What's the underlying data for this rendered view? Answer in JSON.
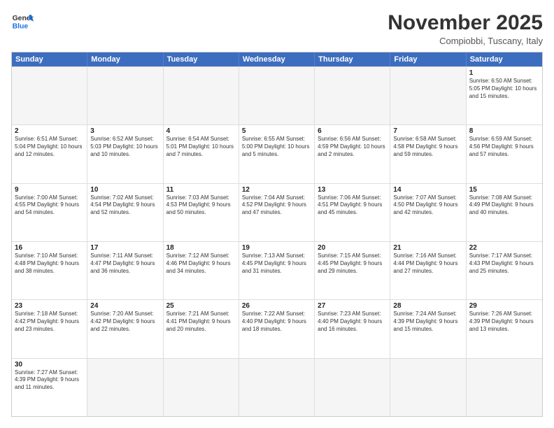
{
  "header": {
    "logo_general": "General",
    "logo_blue": "Blue",
    "month_year": "November 2025",
    "location": "Compiobbi, Tuscany, Italy"
  },
  "days_of_week": [
    "Sunday",
    "Monday",
    "Tuesday",
    "Wednesday",
    "Thursday",
    "Friday",
    "Saturday"
  ],
  "weeks": [
    [
      {
        "day": "",
        "info": ""
      },
      {
        "day": "",
        "info": ""
      },
      {
        "day": "",
        "info": ""
      },
      {
        "day": "",
        "info": ""
      },
      {
        "day": "",
        "info": ""
      },
      {
        "day": "",
        "info": ""
      },
      {
        "day": "1",
        "info": "Sunrise: 6:50 AM\nSunset: 5:05 PM\nDaylight: 10 hours and 15 minutes."
      }
    ],
    [
      {
        "day": "2",
        "info": "Sunrise: 6:51 AM\nSunset: 5:04 PM\nDaylight: 10 hours and 12 minutes."
      },
      {
        "day": "3",
        "info": "Sunrise: 6:52 AM\nSunset: 5:03 PM\nDaylight: 10 hours and 10 minutes."
      },
      {
        "day": "4",
        "info": "Sunrise: 6:54 AM\nSunset: 5:01 PM\nDaylight: 10 hours and 7 minutes."
      },
      {
        "day": "5",
        "info": "Sunrise: 6:55 AM\nSunset: 5:00 PM\nDaylight: 10 hours and 5 minutes."
      },
      {
        "day": "6",
        "info": "Sunrise: 6:56 AM\nSunset: 4:59 PM\nDaylight: 10 hours and 2 minutes."
      },
      {
        "day": "7",
        "info": "Sunrise: 6:58 AM\nSunset: 4:58 PM\nDaylight: 9 hours and 59 minutes."
      },
      {
        "day": "8",
        "info": "Sunrise: 6:59 AM\nSunset: 4:56 PM\nDaylight: 9 hours and 57 minutes."
      }
    ],
    [
      {
        "day": "9",
        "info": "Sunrise: 7:00 AM\nSunset: 4:55 PM\nDaylight: 9 hours and 54 minutes."
      },
      {
        "day": "10",
        "info": "Sunrise: 7:02 AM\nSunset: 4:54 PM\nDaylight: 9 hours and 52 minutes."
      },
      {
        "day": "11",
        "info": "Sunrise: 7:03 AM\nSunset: 4:53 PM\nDaylight: 9 hours and 50 minutes."
      },
      {
        "day": "12",
        "info": "Sunrise: 7:04 AM\nSunset: 4:52 PM\nDaylight: 9 hours and 47 minutes."
      },
      {
        "day": "13",
        "info": "Sunrise: 7:06 AM\nSunset: 4:51 PM\nDaylight: 9 hours and 45 minutes."
      },
      {
        "day": "14",
        "info": "Sunrise: 7:07 AM\nSunset: 4:50 PM\nDaylight: 9 hours and 42 minutes."
      },
      {
        "day": "15",
        "info": "Sunrise: 7:08 AM\nSunset: 4:49 PM\nDaylight: 9 hours and 40 minutes."
      }
    ],
    [
      {
        "day": "16",
        "info": "Sunrise: 7:10 AM\nSunset: 4:48 PM\nDaylight: 9 hours and 38 minutes."
      },
      {
        "day": "17",
        "info": "Sunrise: 7:11 AM\nSunset: 4:47 PM\nDaylight: 9 hours and 36 minutes."
      },
      {
        "day": "18",
        "info": "Sunrise: 7:12 AM\nSunset: 4:46 PM\nDaylight: 9 hours and 34 minutes."
      },
      {
        "day": "19",
        "info": "Sunrise: 7:13 AM\nSunset: 4:45 PM\nDaylight: 9 hours and 31 minutes."
      },
      {
        "day": "20",
        "info": "Sunrise: 7:15 AM\nSunset: 4:45 PM\nDaylight: 9 hours and 29 minutes."
      },
      {
        "day": "21",
        "info": "Sunrise: 7:16 AM\nSunset: 4:44 PM\nDaylight: 9 hours and 27 minutes."
      },
      {
        "day": "22",
        "info": "Sunrise: 7:17 AM\nSunset: 4:43 PM\nDaylight: 9 hours and 25 minutes."
      }
    ],
    [
      {
        "day": "23",
        "info": "Sunrise: 7:18 AM\nSunset: 4:42 PM\nDaylight: 9 hours and 23 minutes."
      },
      {
        "day": "24",
        "info": "Sunrise: 7:20 AM\nSunset: 4:42 PM\nDaylight: 9 hours and 22 minutes."
      },
      {
        "day": "25",
        "info": "Sunrise: 7:21 AM\nSunset: 4:41 PM\nDaylight: 9 hours and 20 minutes."
      },
      {
        "day": "26",
        "info": "Sunrise: 7:22 AM\nSunset: 4:40 PM\nDaylight: 9 hours and 18 minutes."
      },
      {
        "day": "27",
        "info": "Sunrise: 7:23 AM\nSunset: 4:40 PM\nDaylight: 9 hours and 16 minutes."
      },
      {
        "day": "28",
        "info": "Sunrise: 7:24 AM\nSunset: 4:39 PM\nDaylight: 9 hours and 15 minutes."
      },
      {
        "day": "29",
        "info": "Sunrise: 7:26 AM\nSunset: 4:39 PM\nDaylight: 9 hours and 13 minutes."
      }
    ],
    [
      {
        "day": "30",
        "info": "Sunrise: 7:27 AM\nSunset: 4:39 PM\nDaylight: 9 hours and 11 minutes."
      },
      {
        "day": "",
        "info": ""
      },
      {
        "day": "",
        "info": ""
      },
      {
        "day": "",
        "info": ""
      },
      {
        "day": "",
        "info": ""
      },
      {
        "day": "",
        "info": ""
      },
      {
        "day": "",
        "info": ""
      }
    ]
  ]
}
